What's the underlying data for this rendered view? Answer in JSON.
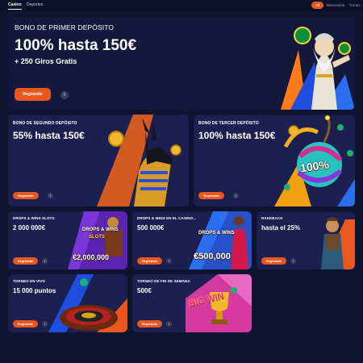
{
  "nav": {
    "tabs": [
      {
        "label": "Casino",
        "active": true
      },
      {
        "label": "Deportes",
        "active": false
      }
    ],
    "filters": [
      {
        "label": "All",
        "active": true
      },
      {
        "label": "Bienvenida",
        "active": false
      },
      {
        "label": "Torneo",
        "active": false
      }
    ]
  },
  "colors": {
    "accent": "#e8581e",
    "background": "#0f1430",
    "card": "#1c2050"
  },
  "hero": {
    "label": "BONO DE PRIMER DEPÓSITO",
    "title": "100% hasta 150€",
    "subtitle": "+ 250 Giros Gratis",
    "button": "Regístrate",
    "info_icon": "i"
  },
  "promos_mid": [
    {
      "label": "BONO DE SEGUNDO DEPÓSITO",
      "title": "55% hasta 150€",
      "button": "Regístrate",
      "info_icon": "i"
    },
    {
      "label": "BONO DE TERCER DEPÓSITO",
      "title": "100% hasta 150€",
      "button": "Regístrate",
      "info_icon": "i",
      "art_text": "100%"
    }
  ],
  "promos_small": [
    {
      "label": "DROPS & WINS SLOTS",
      "title": "2 000 000€",
      "button": "Regístrate",
      "info_icon": "i",
      "art_top": "DROPS & WINS",
      "art_mid": "SLOTS",
      "art_amount": "€2,000,000"
    },
    {
      "label": "DROPS & WINS EN EL CASINO...",
      "title": "500 000€",
      "button": "Regístrate",
      "info_icon": "i",
      "art_top": "DROPS & WINS",
      "art_amount": "€500,000"
    },
    {
      "label": "RAKEBACK",
      "title": "hasta el 25%",
      "button": "Regístrate",
      "info_icon": "i"
    },
    {
      "label": "TORNEO EN VIVO",
      "title": "15 000 puntos",
      "button": "Regístrate",
      "info_icon": "i"
    },
    {
      "label": "TORNEO DE FIN DE SEMANA",
      "title": "500€",
      "button": "Regístrate",
      "info_icon": "i",
      "art_text": "BIG WIN"
    }
  ]
}
